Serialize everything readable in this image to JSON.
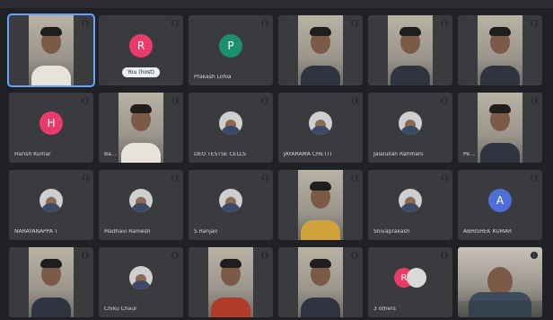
{
  "meeting": {
    "tiles": [
      {
        "row": 0,
        "col": 0,
        "type": "self-video",
        "name": "",
        "self": true
      },
      {
        "row": 0,
        "col": 1,
        "type": "avatar",
        "initial": "R",
        "avatar_color": "#e93c6a",
        "name": "",
        "pill": "You (host)"
      },
      {
        "row": 0,
        "col": 2,
        "type": "avatar",
        "initial": "P",
        "avatar_color": "#1b8f6f",
        "name": "Prakash Lohia"
      },
      {
        "row": 0,
        "col": 3,
        "type": "video",
        "name": "",
        "torso": "dark"
      },
      {
        "row": 0,
        "col": 4,
        "type": "video",
        "name": "",
        "torso": "dark"
      },
      {
        "row": 0,
        "col": 5,
        "type": "video",
        "name": "",
        "torso": "dark"
      },
      {
        "row": 1,
        "col": 0,
        "type": "avatar",
        "initial": "H",
        "avatar_color": "#e93c6a",
        "name": "Harish Kumar"
      },
      {
        "row": 1,
        "col": 1,
        "type": "video",
        "name": "Ba…",
        "torso": "light"
      },
      {
        "row": 1,
        "col": 2,
        "type": "profile",
        "name": "DEO TESTSE CELLS"
      },
      {
        "row": 1,
        "col": 3,
        "type": "profile",
        "name": "JAYARAMA CHETTI"
      },
      {
        "row": 1,
        "col": 4,
        "type": "profile",
        "name": "Jalalullah Rahmani"
      },
      {
        "row": 1,
        "col": 5,
        "type": "video",
        "name": "Pe…",
        "torso": "dark"
      },
      {
        "row": 2,
        "col": 0,
        "type": "profile",
        "name": "NARAYANAPPA T"
      },
      {
        "row": 2,
        "col": 1,
        "type": "profile",
        "name": "Madhavi Ramesh"
      },
      {
        "row": 2,
        "col": 2,
        "type": "profile",
        "name": "S Ranjan"
      },
      {
        "row": 2,
        "col": 3,
        "type": "video",
        "name": "",
        "torso": "yellow"
      },
      {
        "row": 2,
        "col": 4,
        "type": "profile",
        "name": "Shivaprakash"
      },
      {
        "row": 2,
        "col": 5,
        "type": "avatar",
        "initial": "A",
        "avatar_color": "#4f6ed6",
        "name": "ABHISHEK KUMAR"
      },
      {
        "row": 3,
        "col": 0,
        "type": "video",
        "name": "",
        "torso": "dark"
      },
      {
        "row": 3,
        "col": 1,
        "type": "profile",
        "name": "Chiku Chaur"
      },
      {
        "row": 3,
        "col": 2,
        "type": "video",
        "name": "",
        "torso": "red"
      },
      {
        "row": 3,
        "col": 3,
        "type": "video",
        "name": "",
        "torso": "dark"
      },
      {
        "row": 3,
        "col": 4,
        "type": "pair",
        "initial": "R",
        "name": "3 others"
      },
      {
        "row": 3,
        "col": 5,
        "type": "fullvideo",
        "name": ""
      }
    ]
  },
  "icons": {
    "mic": "mic-off-icon",
    "self_badge": "more-options-icon"
  }
}
